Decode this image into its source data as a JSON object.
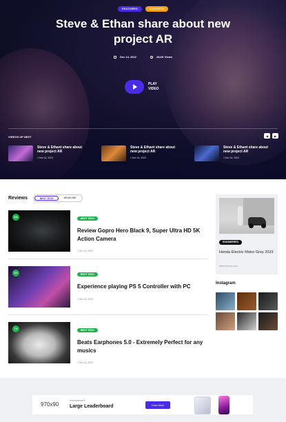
{
  "hero": {
    "tags": [
      "FEATURED",
      "GADGETS"
    ],
    "title": "Steve & Ethan share about new project AR",
    "date": "Dec 14, 2022",
    "views": "28,6K Views",
    "play_label_1": "PLAY",
    "play_label_2": "VIDEO",
    "videos_up_next_label": "VIDEOS UP NEXT",
    "up_next": [
      {
        "title": "Steve & Ethant share about new project AR",
        "date": "Dec 14, 2022"
      },
      {
        "title": "Steve & Ethant share about new project AR",
        "date": "Dec 14, 2022"
      },
      {
        "title": "Steve & Ethant share about new project AR",
        "date": "Dec 14, 2022"
      }
    ]
  },
  "reviews": {
    "title": "Reviews",
    "segments": [
      "BEST TECH",
      "HEADLINE"
    ],
    "items": [
      {
        "score": "8.6",
        "tag": "BEST TECH",
        "title": "Review Gopro Hero Black 9, Super Ultra HD 5K Action Camera",
        "date": "Dec 14, 2022"
      },
      {
        "score": "8.3",
        "tag": "BEST TECH",
        "title": "Experience playing PS 5 Controller with PC",
        "date": "Dec 14, 2022"
      },
      {
        "score": "7.5",
        "tag": "BEST TECH",
        "title": "Beats Earphones 5.0 - Extremely Perfect for any musics",
        "date": "Dec 14, 2022"
      }
    ]
  },
  "sidebar": {
    "card_tag": "ENGINEERED",
    "card_title": "Honda Electric Motor Grey 2023",
    "card_sub": "slide:themes.com",
    "instagram_title": "Instagram"
  },
  "ad": {
    "size": "970x90",
    "small_label": "Advertisement",
    "title": "Large Leaderboard",
    "button": "Learn More"
  },
  "colors": {
    "accent": "#4a2be8",
    "green": "#22b14c",
    "orange": "#f2a21b"
  }
}
